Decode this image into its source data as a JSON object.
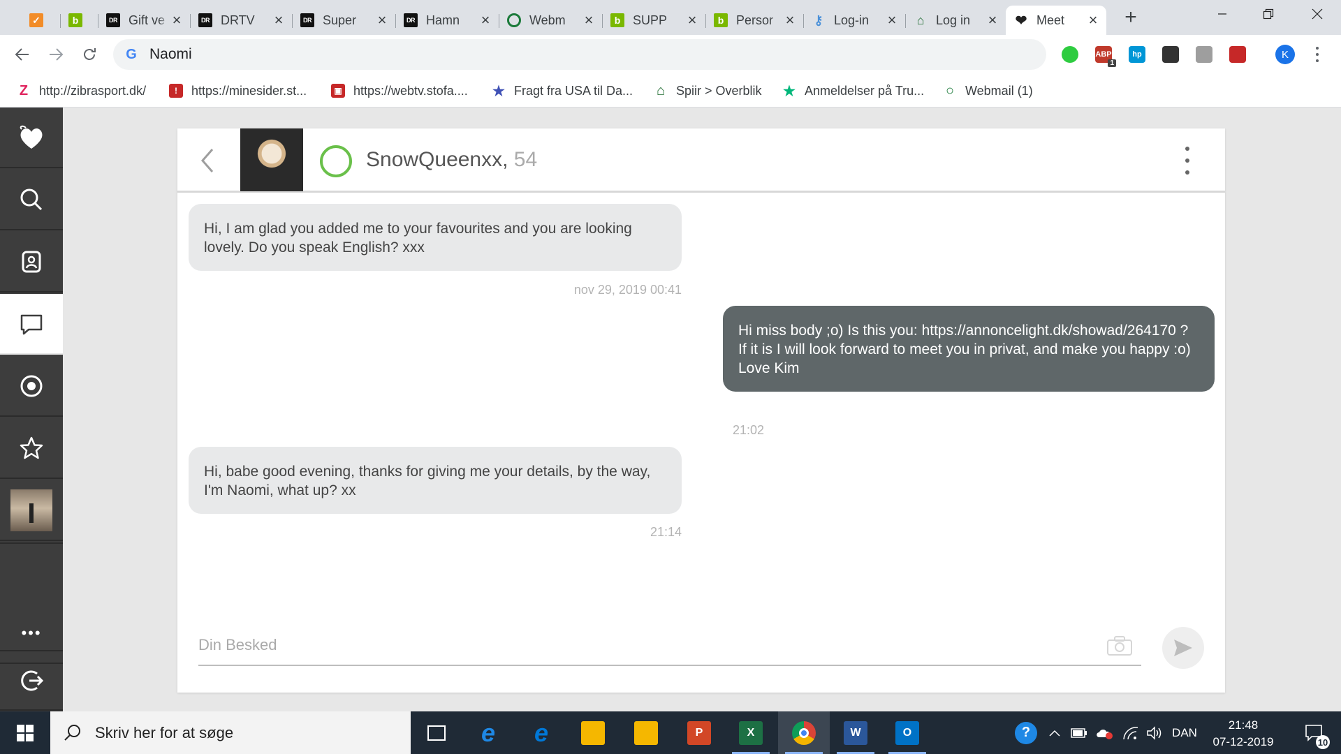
{
  "browser": {
    "tabs": [
      {
        "title": "",
        "favicon": "orange-favicon",
        "color": "#f28c28"
      },
      {
        "title": "",
        "favicon": "b-favicon",
        "color": "#7ab800"
      },
      {
        "title": "Gift ve",
        "favicon": "dr-favicon",
        "color": "#111111"
      },
      {
        "title": "DRTV",
        "favicon": "dr-favicon",
        "color": "#111111"
      },
      {
        "title": "Super",
        "favicon": "dr-favicon",
        "color": "#111111"
      },
      {
        "title": "Hamn",
        "favicon": "dr-favicon",
        "color": "#111111"
      },
      {
        "title": "Webm",
        "favicon": "webmail-favicon",
        "color": "#1b7a3a"
      },
      {
        "title": "SUPP",
        "favicon": "b-favicon",
        "color": "#7ab800"
      },
      {
        "title": "Persor",
        "favicon": "b-favicon",
        "color": "#7ab800"
      },
      {
        "title": "Log-in",
        "favicon": "key-favicon",
        "color": "#4a90d9"
      },
      {
        "title": "Log in",
        "favicon": "spiir-favicon",
        "color": "#1d6b2f"
      },
      {
        "title": "Meet",
        "favicon": "heart-favicon",
        "color": "#222222",
        "active": true
      }
    ],
    "address": "Naomi",
    "profile_initial": "K",
    "extensions": [
      {
        "name": "green-extension-icon",
        "label": "",
        "color": "#2ecc40"
      },
      {
        "name": "adblock-icon",
        "label": "ABP",
        "color": "#c0392b",
        "badge": "1"
      },
      {
        "name": "hp-icon",
        "label": "hp",
        "color": "#0096d6"
      },
      {
        "name": "globe-extension-icon",
        "label": "",
        "color": "#333333"
      },
      {
        "name": "gray-extension-icon",
        "label": "",
        "color": "#9e9e9e"
      },
      {
        "name": "pdf-extension-icon",
        "label": "",
        "color": "#c62828"
      }
    ],
    "bookmarks": [
      {
        "label": "http://zibrasport.dk/",
        "icon": "z-icon",
        "color": "#e0245e"
      },
      {
        "label": "https://minesider.st...",
        "icon": "stofa-icon",
        "color": "#c62828"
      },
      {
        "label": "https://webtv.stofa....",
        "icon": "webtv-icon",
        "color": "#c62828"
      },
      {
        "label": "Fragt fra USA til Da...",
        "icon": "star-badge-icon",
        "color": "#3f51b5"
      },
      {
        "label": "Spiir > Overblik",
        "icon": "spiir-icon",
        "color": "#1d6b2f"
      },
      {
        "label": "Anmeldelser på Tru...",
        "icon": "trustpilot-star-icon",
        "color": "#00b67a"
      },
      {
        "label": "Webmail (1)",
        "icon": "webmail-icon",
        "color": "#1b7a3a"
      }
    ]
  },
  "chat": {
    "profile_name": "SnowQueenxx,",
    "profile_age": "54",
    "messages": [
      {
        "direction": "in",
        "text": "Hi, I am glad you added me to your favourites and you are looking lovely. Do you speak English? xxx",
        "time": "nov 29, 2019 00:41"
      },
      {
        "direction": "out",
        "text": "Hi miss body ;o) Is this you: https://annoncelight.dk/showad/264170 ? If it is I will look forward to meet you in privat, and make you happy :o) Love Kim",
        "time": "21:02"
      },
      {
        "direction": "in",
        "text": "Hi, babe good evening, thanks for giving me your details, by the way, I'm Naomi, what up? xx",
        "time": "21:14"
      }
    ],
    "composer_placeholder": "Din Besked"
  },
  "sidebar": {
    "items": [
      "logo",
      "search",
      "contacts",
      "messages",
      "visitors",
      "favourites",
      "my-profile",
      "more",
      "logout"
    ],
    "more_label": "•••"
  },
  "taskbar": {
    "search_placeholder": "Skriv her for at søge",
    "apps": [
      {
        "name": "task-view-icon",
        "label": ""
      },
      {
        "name": "internet-explorer-icon",
        "label": "e",
        "color": "#1e88e5"
      },
      {
        "name": "edge-icon",
        "label": "e",
        "color": "#0078d7"
      },
      {
        "name": "file-explorer-icon",
        "label": "",
        "color": "#f5b700"
      },
      {
        "name": "onedrive-files-icon",
        "label": "",
        "color": "#f5b700"
      },
      {
        "name": "powerpoint-icon",
        "label": "P",
        "color": "#d24726"
      },
      {
        "name": "excel-icon",
        "label": "X",
        "color": "#1d7044"
      },
      {
        "name": "chrome-icon",
        "label": "",
        "color": "#db4437"
      },
      {
        "name": "word-icon",
        "label": "W",
        "color": "#2b579a"
      },
      {
        "name": "outlook-icon",
        "label": "O",
        "color": "#0072c6"
      }
    ],
    "language": "DAN",
    "time": "21:48",
    "date": "07-12-2019",
    "notification_count": "10"
  }
}
